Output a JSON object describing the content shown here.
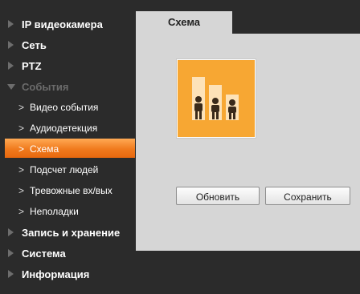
{
  "sidebar": {
    "items": [
      {
        "label": "IP видеокамера"
      },
      {
        "label": "Сеть"
      },
      {
        "label": "PTZ"
      },
      {
        "label": "События"
      },
      {
        "label": "Запись и хранение"
      },
      {
        "label": "Система"
      },
      {
        "label": "Информация"
      }
    ],
    "events_sub": [
      {
        "label": "Видео события"
      },
      {
        "label": "Аудиодетекция"
      },
      {
        "label": "Схема"
      },
      {
        "label": "Подсчет людей"
      },
      {
        "label": "Тревожные вх/вых"
      },
      {
        "label": "Неполадки"
      }
    ]
  },
  "main": {
    "tab_label": "Схема",
    "refresh_label": "Обновить",
    "save_label": "Сохранить"
  },
  "colors": {
    "accent": "#f07a1d",
    "tile": "#f7a733",
    "panel": "#d6d6d6",
    "sidebar": "#2b2b2b"
  }
}
